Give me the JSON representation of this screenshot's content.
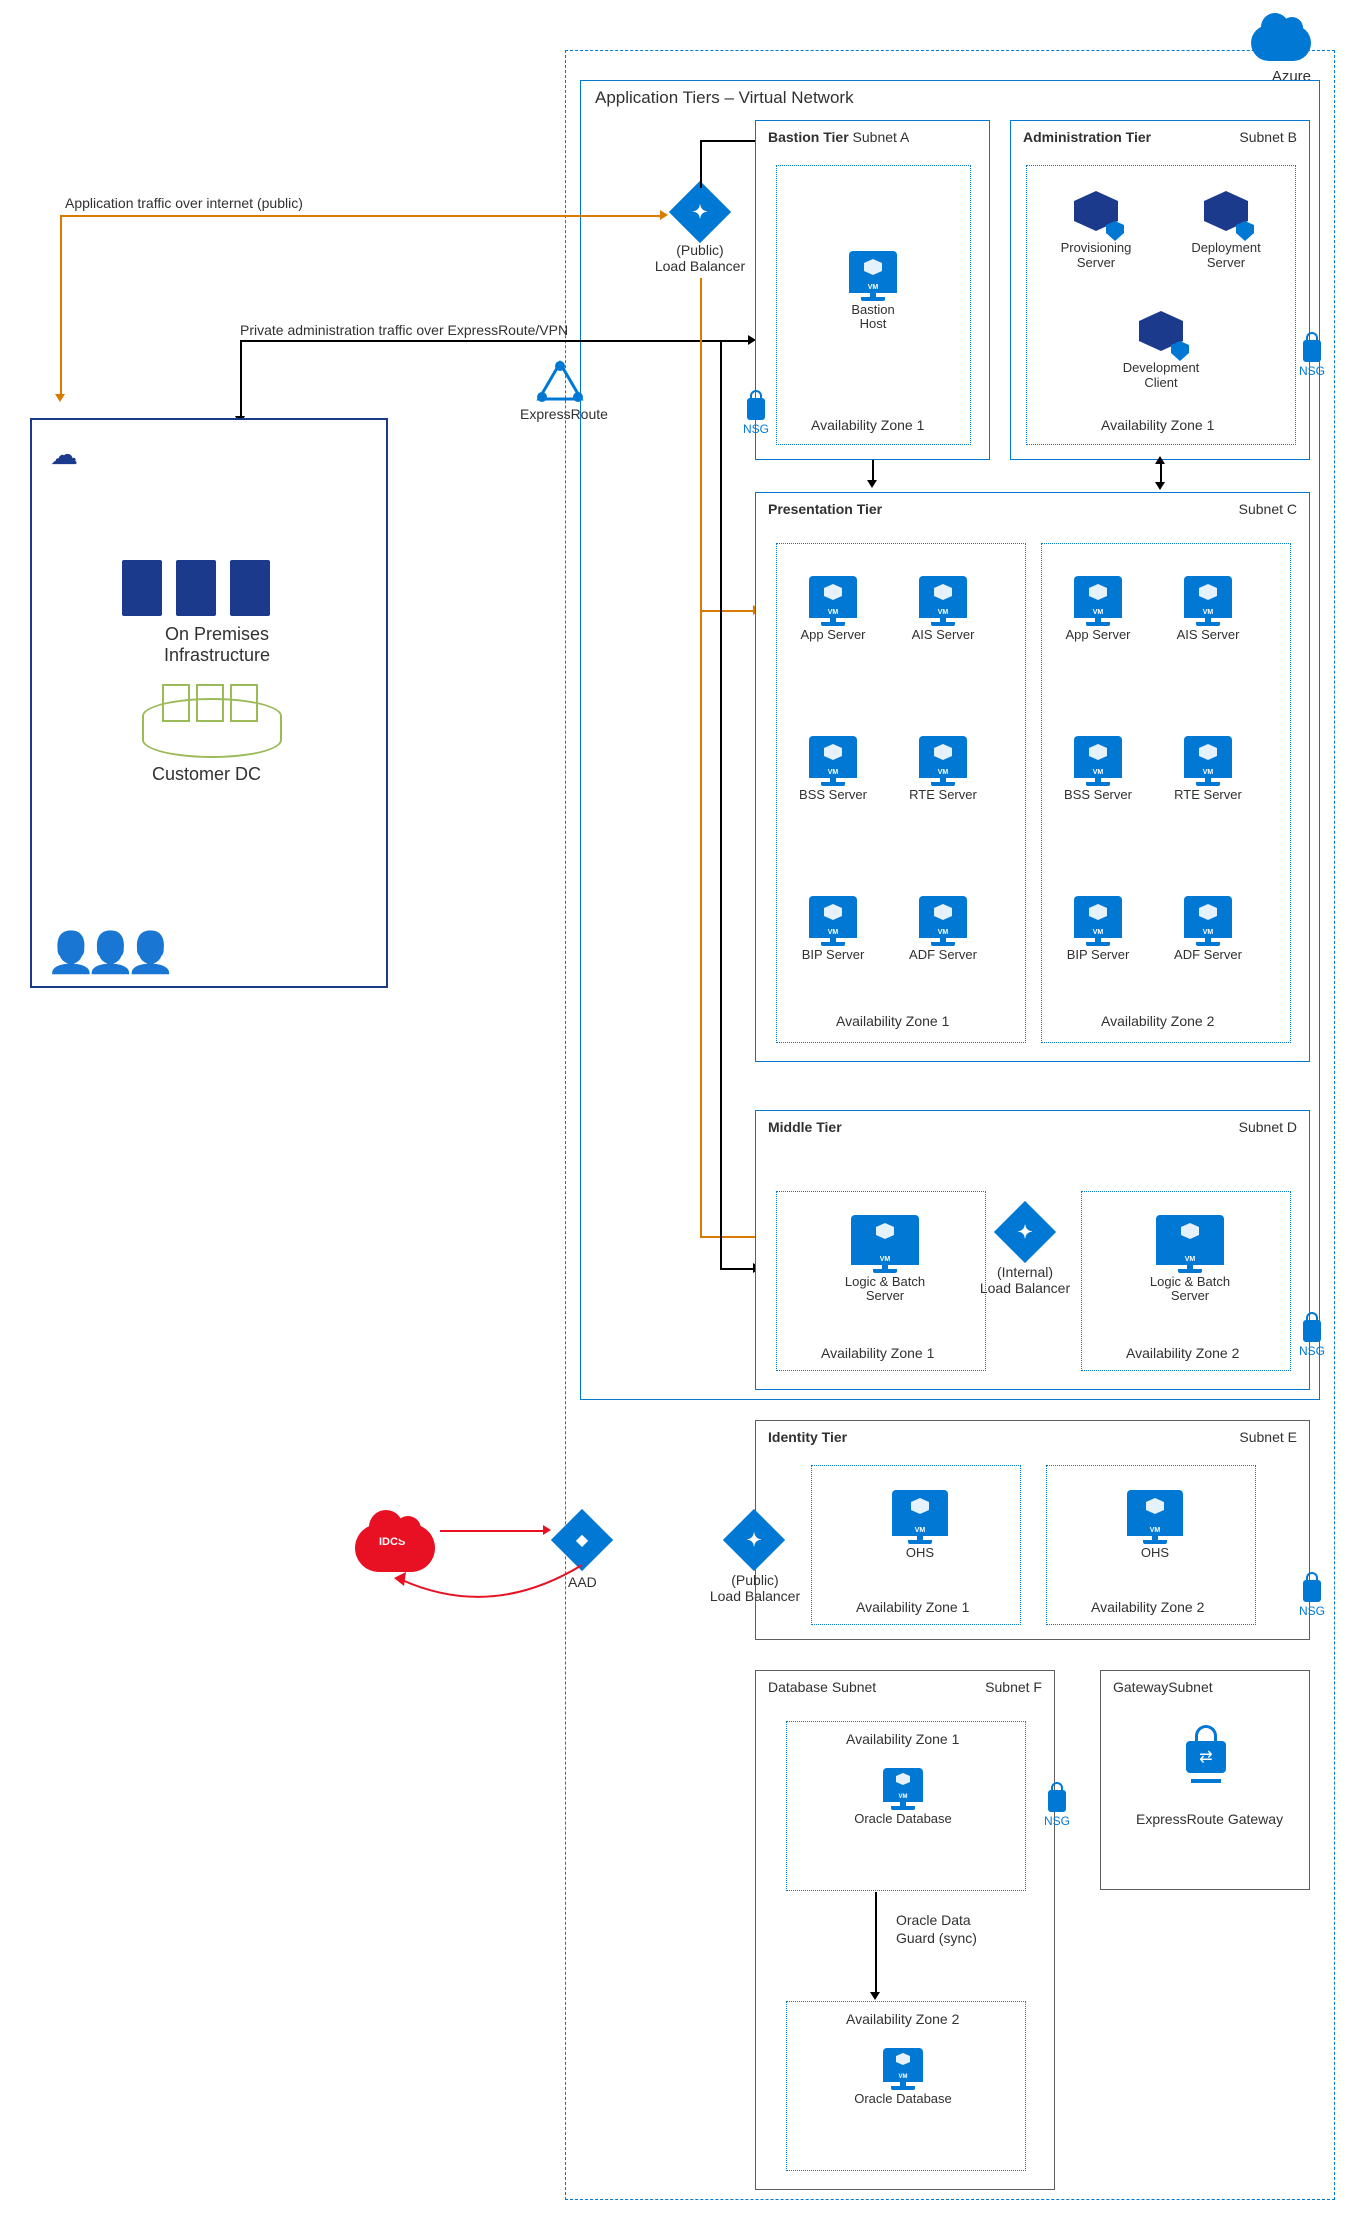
{
  "azure_label": "Azure",
  "vnet_title": "Application Tiers – Virtual Network",
  "traffic_public": "Application traffic over internet (public)",
  "traffic_private": "Private administration traffic over ExpressRoute/VPN",
  "public_lb": "(Public)\nLoad Balancer",
  "internal_lb": "(Internal)\nLoad Balancer",
  "public_lb2": "(Public)\nLoad Balancer",
  "expressroute": "ExpressRoute",
  "nsg": "NSG",
  "onprem": {
    "infra": "On Premises\nInfrastructure",
    "dc": "Customer DC"
  },
  "idcs": "IDCS",
  "aad": "AAD",
  "tiers": {
    "bastion": {
      "title": "Bastion Tier",
      "subnet": "Subnet A",
      "host": "Bastion Host",
      "az": "Availability Zone 1"
    },
    "admin": {
      "title": "Administration Tier",
      "subnet": "Subnet B",
      "provisioning": "Provisioning\nServer",
      "deployment": "Deployment\nServer",
      "dev": "Development\nClient",
      "az": "Availability Zone 1"
    },
    "presentation": {
      "title": "Presentation Tier",
      "subnet": "Subnet C",
      "vms": [
        "App Server",
        "AIS Server",
        "BSS Server",
        "RTE Server",
        "BIP Server",
        "ADF Server"
      ],
      "az1": "Availability Zone 1",
      "az2": "Availability Zone 2"
    },
    "middle": {
      "title": "Middle Tier",
      "subnet": "Subnet D",
      "logic": "Logic & Batch Server",
      "az1": "Availability Zone 1",
      "az2": "Availability Zone 2"
    },
    "identity": {
      "title": "Identity Tier",
      "subnet": "Subnet E",
      "ohs": "OHS",
      "az1": "Availability Zone 1",
      "az2": "Availability Zone 2"
    },
    "db": {
      "title": "Database Subnet",
      "subnet": "Subnet F",
      "oracle": "Oracle Database",
      "az1": "Availability Zone 1",
      "az2": "Availability Zone 2",
      "dg": "Oracle Data\nGuard (sync)"
    },
    "gateway": {
      "title": "GatewaySubnet",
      "er": "ExpressRoute Gateway"
    }
  }
}
